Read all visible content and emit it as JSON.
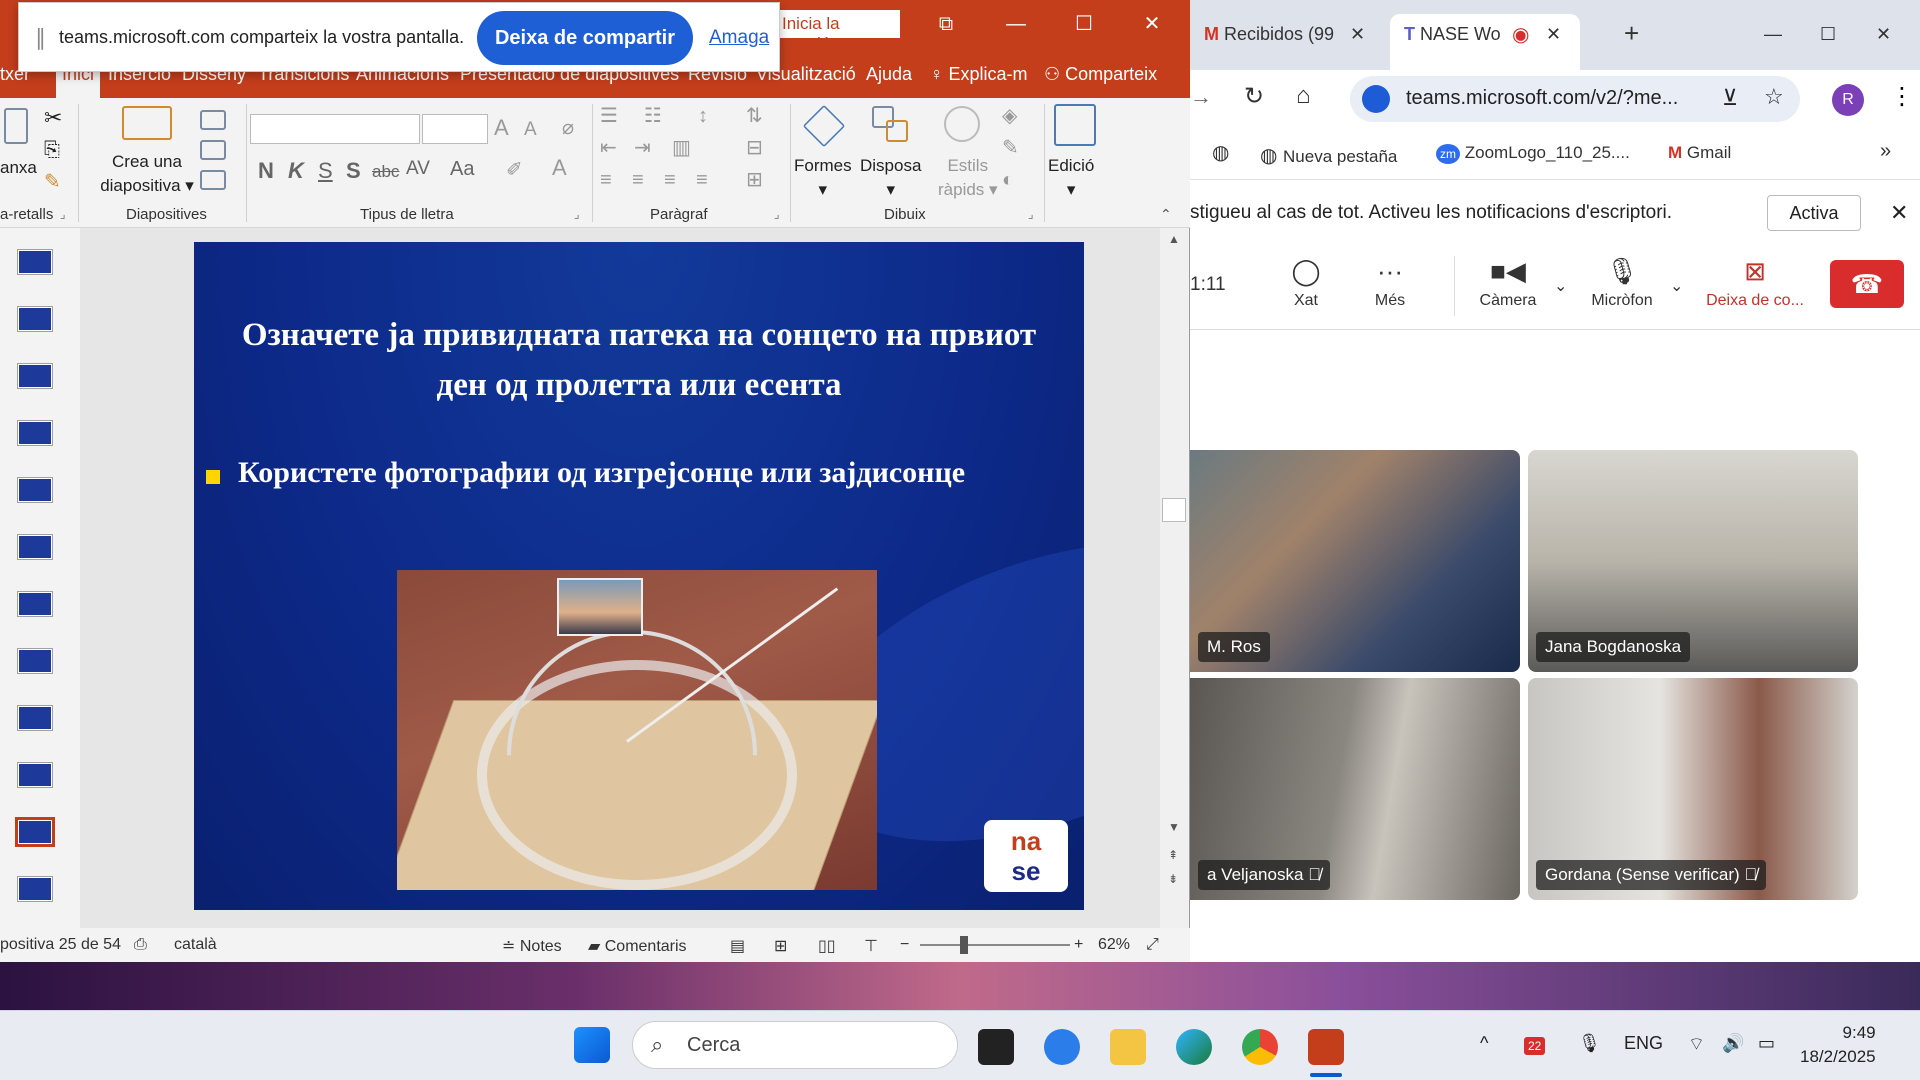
{
  "share_bar": {
    "message": "teams.microsoft.com comparteix la vostra pantalla.",
    "stop_label": "Deixa de compartir",
    "hide_label": "Amaga"
  },
  "ppt": {
    "login_label": "Inicia la sessió",
    "tabs": [
      "txer",
      "Inici",
      "Inserció",
      "Disseny",
      "Transicions",
      "Animacions",
      "Presentació de diapositives",
      "Revisió",
      "Visualització",
      "Ajuda",
      "Explica-m",
      "Comparteix"
    ],
    "ribbon": {
      "paste_label": "anxa",
      "new_slide_label_1": "Crea una",
      "new_slide_label_2": "diapositiva",
      "shapes_label": "Formes",
      "arrange_label": "Disposa",
      "quick_styles_label_1": "Estils",
      "quick_styles_label_2": "ràpids",
      "editing_label": "Edició",
      "groups": {
        "clipboard": "a-retalls",
        "slides": "Diapositives",
        "font": "Tipus de lletra",
        "paragraph": "Paràgraf",
        "drawing": "Dibuix"
      },
      "font_format_glyphs": [
        "N",
        "K",
        "S",
        "S",
        "abc",
        "AV",
        "Aa"
      ]
    },
    "slide": {
      "title": "Означете ја привидната патека на сонцето на првиот ден од пролетта или есента",
      "bullet": "Користете фотографии од изгрејсонце или зајдисонце",
      "logo_top": "na",
      "logo_bottom": "se"
    },
    "status": {
      "slide_counter": "positiva 25 de 54",
      "language": "català",
      "notes_label": "Notes",
      "comments_label": "Comentaris",
      "zoom": "62%"
    }
  },
  "chrome": {
    "tabs": [
      {
        "label": "Recibidos (99"
      },
      {
        "label": "NASE Wo"
      }
    ],
    "url": "teams.microsoft.com/v2/?me...",
    "profile_initial": "R",
    "bookmarks": [
      "Nueva pestaña",
      "ZoomLogo_110_25....",
      "Gmail"
    ],
    "notification": {
      "text": "stigueu al cas de tot. Activeu les notificacions d'escriptori.",
      "action": "Activa"
    },
    "meeting": {
      "timer": "1:11",
      "buttons": {
        "chat": "Xat",
        "more": "Més",
        "camera": "Càmera",
        "mic": "Micròfon",
        "stop_share": "Deixa de co..."
      }
    },
    "participants": [
      {
        "name": "M. Ros"
      },
      {
        "name": "Jana Bogdanoska"
      },
      {
        "name": "a Veljanoska"
      },
      {
        "name": "Gordana (Sense verificar)"
      }
    ]
  },
  "taskbar": {
    "search_placeholder": "Cerca",
    "language": "ENG",
    "time": "9:49",
    "date": "18/2/2025",
    "badge": "22"
  },
  "colors": {
    "ppt_accent": "#c43e1c",
    "teams_accent": "#1d5cd6",
    "leave_red": "#d92c2c",
    "slide_blue": "#0d2a8a"
  }
}
